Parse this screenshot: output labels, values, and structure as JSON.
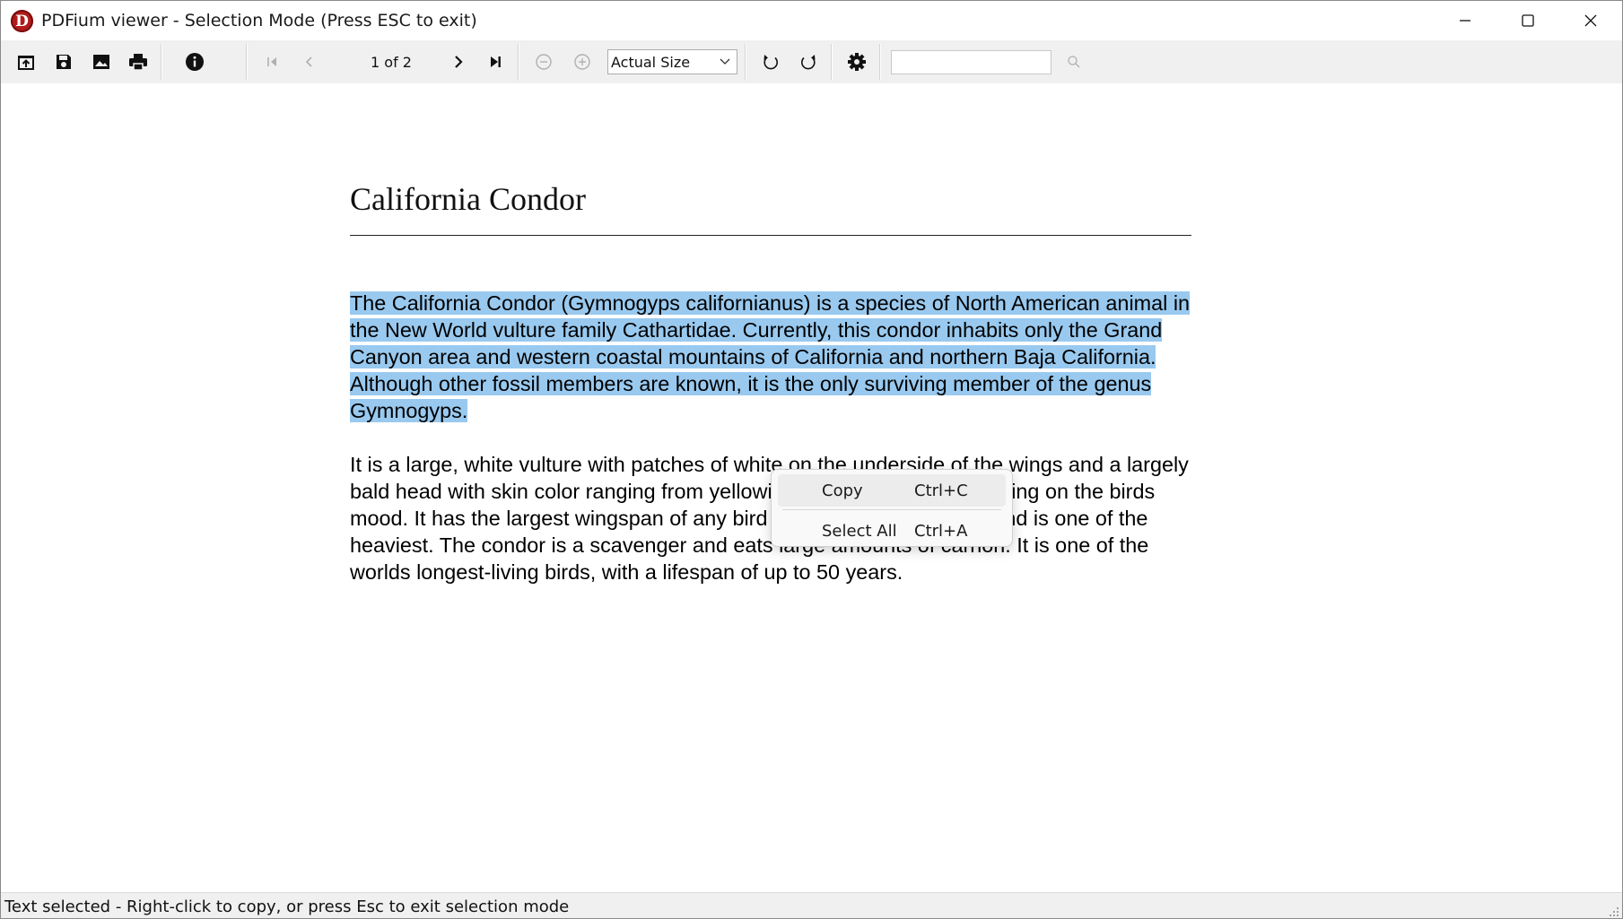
{
  "window": {
    "title": "PDFium viewer - Selection Mode (Press ESC to exit)",
    "app_icon_letter": "D"
  },
  "toolbar": {
    "page_indicator": "1 of 2",
    "zoom_selected": "Actual Size",
    "search_value": ""
  },
  "document": {
    "title": "California Condor",
    "paragraph1_lines": [
      "The California Condor (Gymnogyps californianus) is a species of North American animal in",
      "the New World vulture family Cathartidae. Currently, this condor inhabits only the Grand",
      "Canyon area and western coastal mountains of California and northern Baja California.",
      "Although other fossil members are known, it is the only surviving member of the genus",
      "Gymnogyps."
    ],
    "paragraph2_lines": [
      "It is a large, white vulture with patches of white on the underside of the wings and a largely",
      "bald head with skin color ranging from yellowish to a bright red, depending on the birds",
      "mood. It has the largest wingspan of any bird found in North America and is one of the",
      "heaviest. The condor is a scavenger and eats large amounts of carrion. It is one of the",
      "worlds longest-living birds, with a lifespan of up to 50 years."
    ]
  },
  "context_menu": {
    "items": [
      {
        "label": "Copy",
        "shortcut": "Ctrl+C"
      },
      {
        "label": "Select All",
        "shortcut": "Ctrl+A"
      }
    ]
  },
  "statusbar": {
    "text": "Text selected - Right-click to copy, or press Esc to exit selection mode"
  },
  "colors": {
    "selection": "#99c9ef",
    "toolbar_bg": "#f0f0f0",
    "app_icon": "#b11b1b"
  },
  "icons": {
    "toolbar": [
      "open-icon",
      "save-icon",
      "image-icon",
      "print-icon",
      "info-icon",
      "first-page-icon",
      "prev-page-icon",
      "next-page-icon",
      "last-page-icon",
      "zoom-out-icon",
      "zoom-in-icon",
      "rotate-left-icon",
      "rotate-right-icon",
      "settings-icon",
      "search-icon"
    ]
  }
}
